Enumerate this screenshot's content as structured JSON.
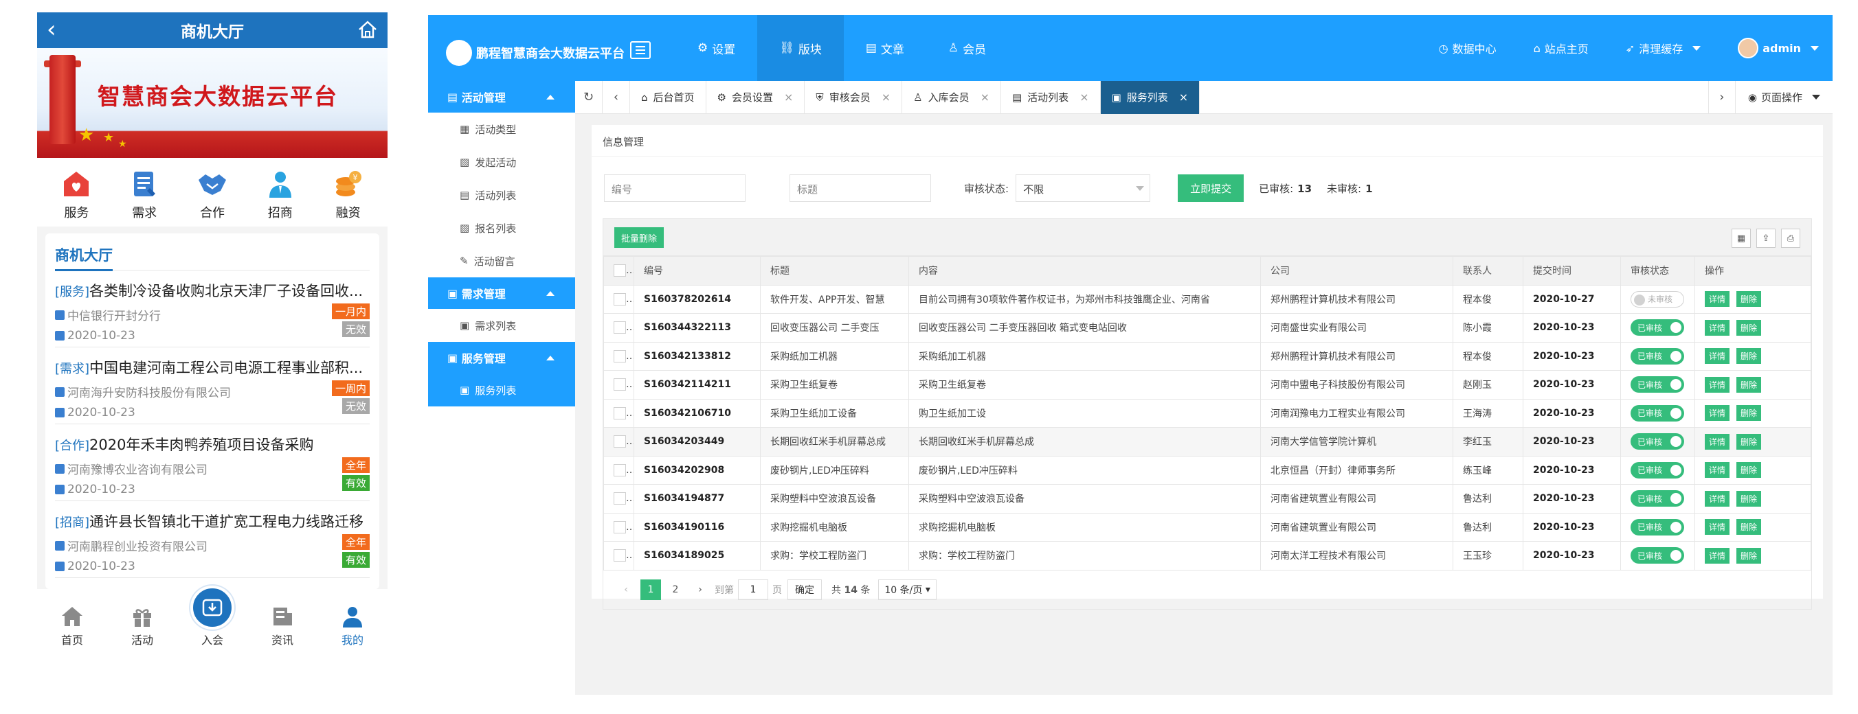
{
  "mobile": {
    "header_title": "商机大厅",
    "banner_text": "智慧商会大数据云平台",
    "icons": [
      {
        "label": "服务",
        "icon": "service-icon",
        "color": "#e8423a"
      },
      {
        "label": "需求",
        "icon": "demand-icon",
        "color": "#3a7fd0"
      },
      {
        "label": "合作",
        "icon": "handshake-icon",
        "color": "#3a7fd0"
      },
      {
        "label": "招商",
        "icon": "recruit-icon",
        "color": "#29a3e0"
      },
      {
        "label": "融资",
        "icon": "coins-icon",
        "color": "#f28a1d"
      }
    ],
    "list_title": "商机大厅",
    "items": [
      {
        "tag": "[服务]",
        "title": "各类制冷设备收购北京天津厂子设备回收...",
        "company": "中信银行开封分行",
        "date": "2020-10-23",
        "badge1": "一月内",
        "badge2": "无效"
      },
      {
        "tag": "[需求]",
        "title": "中国电建河南工程公司电源工程事业部积...",
        "company": "河南海升安防科技股份有限公司",
        "date": "2020-10-23",
        "badge1": "一周内",
        "badge2": "无效"
      },
      {
        "tag": "[合作]",
        "title": "2020年禾丰肉鸭养殖项目设备采购",
        "company": "河南豫博农业咨询有限公司",
        "date": "2020-10-23",
        "badge1": "全年",
        "badge2": "有效"
      },
      {
        "tag": "[招商]",
        "title": "通许县长智镇北干道扩宽工程电力线路迁移",
        "company": "河南鹏程创业投资有限公司",
        "date": "2020-10-23",
        "badge1": "全年",
        "badge2": "有效"
      }
    ],
    "tabbar": [
      {
        "label": "首页"
      },
      {
        "label": "活动"
      },
      {
        "label": "入会"
      },
      {
        "label": "资讯"
      },
      {
        "label": "我的"
      }
    ]
  },
  "admin": {
    "logo_text": "鹏程智慧商会大数据云平台",
    "nav": [
      {
        "label": "设置",
        "icon": "gear-icon"
      },
      {
        "label": "版块",
        "icon": "modules-icon"
      },
      {
        "label": "文章",
        "icon": "article-icon"
      },
      {
        "label": "会员",
        "icon": "user-icon"
      }
    ],
    "right": {
      "data_center": "数据中心",
      "site_home": "站点主页",
      "clear_cache": "清理缓存",
      "user": "admin"
    },
    "sidebar": [
      {
        "group": "活动管理",
        "items": [
          "活动类型",
          "发起活动",
          "活动列表",
          "报名列表",
          "活动留言"
        ]
      },
      {
        "group": "需求管理",
        "items": [
          "需求列表"
        ]
      },
      {
        "group": "服务管理",
        "items": [
          "服务列表"
        ]
      }
    ],
    "tabs": [
      {
        "label": "后台首页",
        "closable": false
      },
      {
        "label": "会员设置",
        "closable": true
      },
      {
        "label": "审核会员",
        "closable": true
      },
      {
        "label": "入库会员",
        "closable": true
      },
      {
        "label": "活动列表",
        "closable": true
      },
      {
        "label": "服务列表",
        "closable": true
      }
    ],
    "page_ops": "页面操作",
    "breadcrumb": "信息管理",
    "filter": {
      "code_placeholder": "编号",
      "title_placeholder": "标题",
      "status_label": "审核状态:",
      "status_value": "不限",
      "submit": "立即提交",
      "approved_label": "已审核:",
      "approved_count": "13",
      "pending_label": "未审核:",
      "pending_count": "1"
    },
    "bulk_delete": "批量删除",
    "columns": [
      "编号",
      "标题",
      "内容",
      "公司",
      "联系人",
      "提交时间",
      "审核状态",
      "操作"
    ],
    "rows": [
      {
        "no": "S160378202614",
        "title": "软件开发、APP开发、智慧",
        "content": "目前公司拥有30项软件著作权证书，为郑州市科技雏鹰企业、河南省",
        "company": "郑州鹏程计算机技术有限公司",
        "contact": "程本俊",
        "time": "2020-10-27",
        "status": "未审核",
        "approved": false
      },
      {
        "no": "S160344322113",
        "title": "回收变压器公司 二手变压",
        "content": "回收变压器公司 二手变压器回收 箱式变电站回收",
        "company": "河南盛世实业有限公司",
        "contact": "陈小霞",
        "time": "2020-10-23",
        "status": "已审核",
        "approved": true
      },
      {
        "no": "S160342133812",
        "title": "采购纸加工机器",
        "content": "采购纸加工机器",
        "company": "郑州鹏程计算机技术有限公司",
        "contact": "程本俊",
        "time": "2020-10-23",
        "status": "已审核",
        "approved": true
      },
      {
        "no": "S160342114211",
        "title": "采购卫生纸复卷",
        "content": "采购卫生纸复卷",
        "company": "河南中盟电子科技股份有限公司",
        "contact": "赵刚玉",
        "time": "2020-10-23",
        "status": "已审核",
        "approved": true
      },
      {
        "no": "S160342106710",
        "title": "采购卫生纸加工设备",
        "content": "购卫生纸加工设",
        "company": "河南润豫电力工程实业有限公司",
        "contact": "王海涛",
        "time": "2020-10-23",
        "status": "已审核",
        "approved": true
      },
      {
        "no": "S16034203449",
        "title": "长期回收红米手机屏幕总成",
        "content": "长期回收红米手机屏幕总成",
        "company": "河南大学信管学院计算机",
        "contact": "李红玉",
        "time": "2020-10-23",
        "status": "已审核",
        "approved": true
      },
      {
        "no": "S16034202908",
        "title": "废砂钢片,LED冲压碎料",
        "content": "废砂钢片,LED冲压碎料",
        "company": "北京恒昌（开封）律师事务所",
        "contact": "练玉峰",
        "time": "2020-10-23",
        "status": "已审核",
        "approved": true
      },
      {
        "no": "S16034194877",
        "title": "采购塑料中空波浪瓦设备",
        "content": "采购塑料中空波浪瓦设备",
        "company": "河南省建筑置业有限公司",
        "contact": "鲁达利",
        "time": "2020-10-23",
        "status": "已审核",
        "approved": true
      },
      {
        "no": "S16034190116",
        "title": "求购挖掘机电脑板",
        "content": "求购挖掘机电脑板",
        "company": "河南省建筑置业有限公司",
        "contact": "鲁达利",
        "time": "2020-10-23",
        "status": "已审核",
        "approved": true
      },
      {
        "no": "S16034189025",
        "title": "求购：学校工程防盗门",
        "content": "求购：学校工程防盗门",
        "company": "河南太洋工程技术有限公司",
        "contact": "王玉珍",
        "time": "2020-10-23",
        "status": "已审核",
        "approved": true
      }
    ],
    "actions": {
      "detail": "详情",
      "delete": "删除"
    },
    "pager": {
      "pages": [
        "1",
        "2"
      ],
      "goto_label": "到第",
      "goto_value": "1",
      "page_unit": "页",
      "confirm": "确定",
      "total_prefix": "共",
      "total_count": "14",
      "total_suffix": "条",
      "page_size": "10 条/页"
    },
    "colors": {
      "primary": "#1e9fff",
      "success": "#35bd7c",
      "active_tab": "#1b5f8f"
    }
  }
}
